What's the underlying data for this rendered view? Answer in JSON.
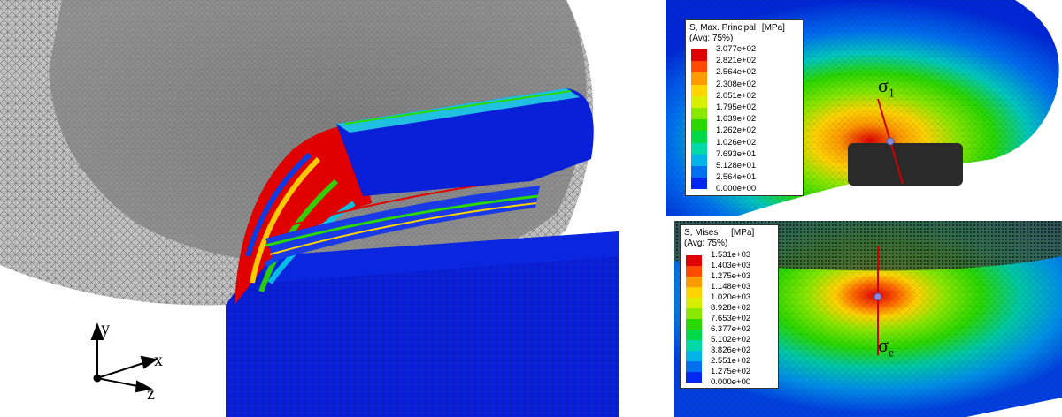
{
  "left_figure": {
    "axes": {
      "y": "y",
      "x": "x",
      "z": "z"
    }
  },
  "top_legend": {
    "title_line1": "S, Max. Principal",
    "unit": "[MPa]",
    "title_line2": "(Avg: 75%)",
    "values": [
      "3.077e+02",
      "2.821e+02",
      "2.564e+02",
      "2.308e+02",
      "2.051e+02",
      "1.795e+02",
      "1.639e+02",
      "1.262e+02",
      "1.026e+02",
      "7.693e+01",
      "5.128e+01",
      "2.564e+01",
      "0.000e+00"
    ],
    "colors": [
      "#e00000",
      "#ff4a00",
      "#ff9a00",
      "#ffd400",
      "#d8f000",
      "#8ae800",
      "#2ad800",
      "#00d84a",
      "#00d8a8",
      "#00b4e8",
      "#0070f0",
      "#0028f0"
    ],
    "marker_label": "σ",
    "marker_subscript": "1"
  },
  "bottom_legend": {
    "title_line1": "S, Mises",
    "unit": "[MPa]",
    "title_line2": "(Avg: 75%)",
    "values": [
      "1.531e+03",
      "1.403e+03",
      "1.275e+03",
      "1.148e+03",
      "1.020e+03",
      "8.928e+02",
      "7.653e+02",
      "6.377e+02",
      "5.102e+02",
      "3.826e+02",
      "2.551e+02",
      "1.275e+02",
      "0.000e+00"
    ],
    "colors": [
      "#e00000",
      "#ff4a00",
      "#ff9a00",
      "#ffd400",
      "#d8f000",
      "#8ae800",
      "#2ad800",
      "#00d84a",
      "#00d8a8",
      "#00b4e8",
      "#0070f0",
      "#0028f0"
    ],
    "marker_label": "σ",
    "marker_subscript": "e"
  }
}
